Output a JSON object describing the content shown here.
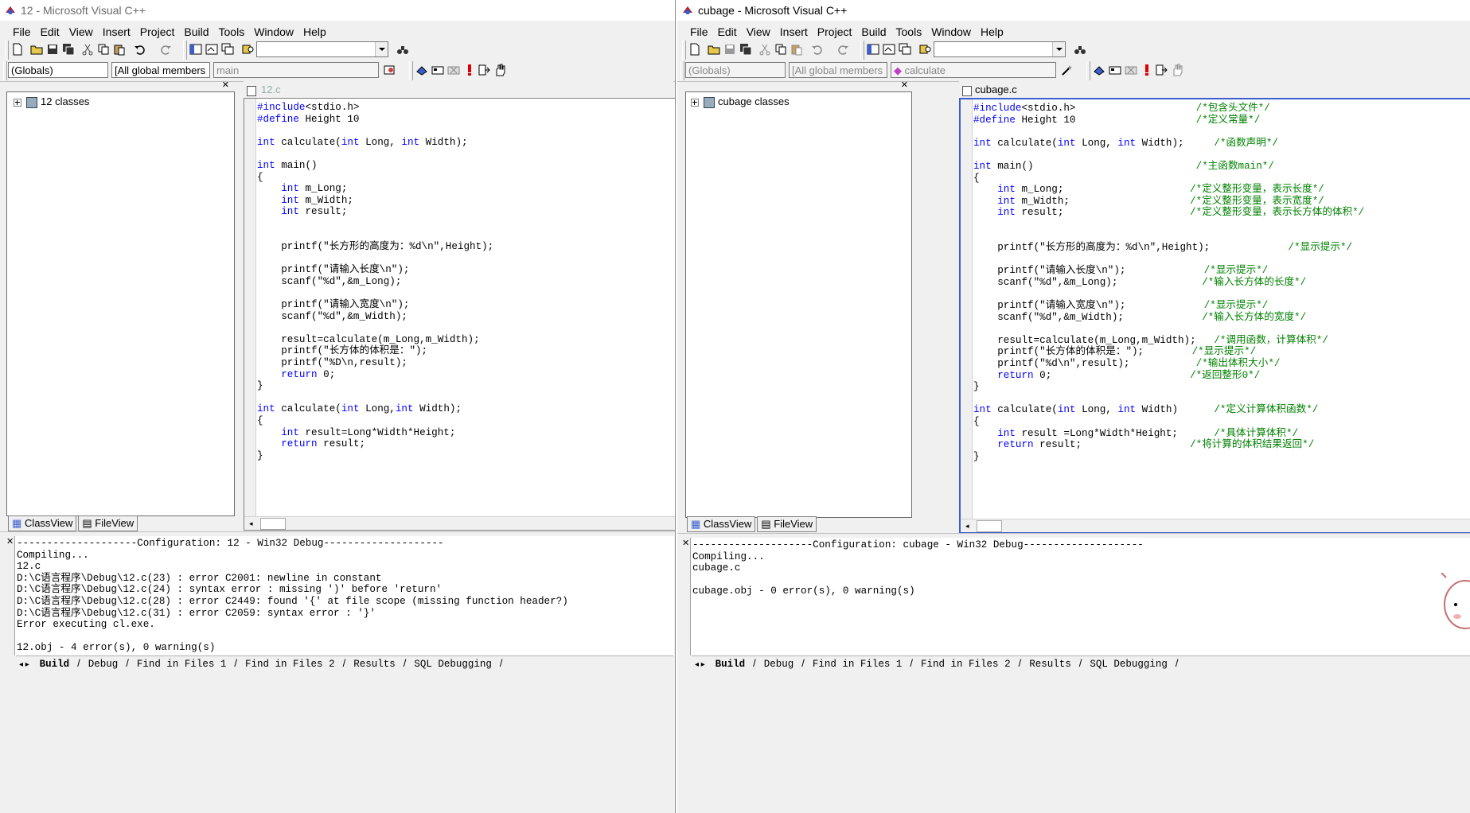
{
  "left_window": {
    "title": "12 - Microsoft Visual C++",
    "menu": [
      "File",
      "Edit",
      "View",
      "Insert",
      "Project",
      "Build",
      "Tools",
      "Window",
      "Help"
    ],
    "combo_class": "(Globals)",
    "combo_members": "[All global members",
    "combo_function": "main",
    "workspace_tree_item": "12 classes",
    "workspace_tabs": [
      "ClassView",
      "FileView"
    ],
    "editor_tab": "12.c",
    "output_tabs": [
      "Build",
      "Debug",
      "Find in Files 1",
      "Find in Files 2",
      "Results",
      "SQL Debugging"
    ],
    "output_lines": [
      "--------------------Configuration: 12 - Win32 Debug--------------------",
      "Compiling...",
      "12.c",
      "D:\\C语言程序\\Debug\\12.c(23) : error C2001: newline in constant",
      "D:\\C语言程序\\Debug\\12.c(24) : syntax error : missing ')' before 'return'",
      "D:\\C语言程序\\Debug\\12.c(28) : error C2449: found '{' at file scope (missing function header?)",
      "D:\\C语言程序\\Debug\\12.c(31) : error C2059: syntax error : '}'",
      "Error executing cl.exe.",
      "",
      "12.obj - 4 error(s), 0 warning(s)"
    ]
  },
  "right_window": {
    "title": "cubage - Microsoft Visual C++",
    "menu": [
      "File",
      "Edit",
      "View",
      "Insert",
      "Project",
      "Build",
      "Tools",
      "Window",
      "Help"
    ],
    "combo_class": "(Globals)",
    "combo_members": "[All global members",
    "combo_function": "calculate",
    "workspace_tree_item": "cubage classes",
    "workspace_tabs": [
      "ClassView",
      "FileView"
    ],
    "editor_tab": "cubage.c",
    "output_tabs": [
      "Build",
      "Debug",
      "Find in Files 1",
      "Find in Files 2",
      "Results",
      "SQL Debugging"
    ],
    "output_lines": [
      "--------------------Configuration: cubage - Win32 Debug--------------------",
      "Compiling...",
      "cubage.c",
      "",
      "cubage.obj - 0 error(s), 0 warning(s)"
    ]
  },
  "left_code": [
    [
      [
        "kw",
        "#include"
      ],
      [
        "",
        "<stdio.h>"
      ]
    ],
    [
      [
        "kw",
        "#define"
      ],
      [
        "",
        " Height 10"
      ]
    ],
    [],
    [
      [
        "kw",
        "int"
      ],
      [
        "",
        " calculate("
      ],
      [
        "kw",
        "int"
      ],
      [
        "",
        " Long, "
      ],
      [
        "kw",
        "int"
      ],
      [
        "",
        " Width);"
      ]
    ],
    [],
    [
      [
        "kw",
        "int"
      ],
      [
        "",
        " main()"
      ]
    ],
    [
      [
        "",
        "{"
      ]
    ],
    [
      [
        "",
        "    "
      ],
      [
        "kw",
        "int"
      ],
      [
        "",
        " m_Long;"
      ]
    ],
    [
      [
        "",
        "    "
      ],
      [
        "kw",
        "int"
      ],
      [
        "",
        " m_Width;"
      ]
    ],
    [
      [
        "",
        "    "
      ],
      [
        "kw",
        "int"
      ],
      [
        "",
        " result;"
      ]
    ],
    [],
    [],
    [
      [
        "",
        "    printf(\"长方形的高度为：%d\\n\",Height);"
      ]
    ],
    [],
    [
      [
        "",
        "    printf(\"请输入长度\\n\");"
      ]
    ],
    [
      [
        "",
        "    scanf(\"%d\",&m_Long);"
      ]
    ],
    [],
    [
      [
        "",
        "    printf(\"请输入宽度\\n\");"
      ]
    ],
    [
      [
        "",
        "    scanf(\"%d\",&m_Width);"
      ]
    ],
    [],
    [
      [
        "",
        "    result=calculate(m_Long,m_Width);"
      ]
    ],
    [
      [
        "",
        "    printf(\"长方体的体积是：\");"
      ]
    ],
    [
      [
        "",
        "    printf(\"%D\\n,result);"
      ]
    ],
    [
      [
        "",
        "    "
      ],
      [
        "kw",
        "return"
      ],
      [
        "",
        " 0;"
      ]
    ],
    [
      [
        "",
        "}"
      ]
    ],
    [],
    [
      [
        "kw",
        "int"
      ],
      [
        "",
        " calculate("
      ],
      [
        "kw",
        "int"
      ],
      [
        "",
        " Long,"
      ],
      [
        "kw",
        "int"
      ],
      [
        "",
        " Width);"
      ]
    ],
    [
      [
        "",
        "{"
      ]
    ],
    [
      [
        "",
        "    "
      ],
      [
        "kw",
        "int"
      ],
      [
        "",
        " result=Long*Width*Height;"
      ]
    ],
    [
      [
        "",
        "    "
      ],
      [
        "kw",
        "return"
      ],
      [
        "",
        " result;"
      ]
    ],
    [
      [
        "",
        "}"
      ]
    ]
  ],
  "right_code": [
    [
      [
        "kw",
        "#include"
      ],
      [
        "",
        "<stdio.h>                    "
      ],
      [
        "cm",
        "/*包含头文件*/"
      ]
    ],
    [
      [
        "kw",
        "#define"
      ],
      [
        "",
        " Height 10                    "
      ],
      [
        "cm",
        "/*定义常量*/"
      ]
    ],
    [],
    [
      [
        "kw",
        "int"
      ],
      [
        "",
        " calculate("
      ],
      [
        "kw",
        "int"
      ],
      [
        "",
        " Long, "
      ],
      [
        "kw",
        "int"
      ],
      [
        "",
        " Width);     "
      ],
      [
        "cm",
        "/*函数声明*/"
      ]
    ],
    [],
    [
      [
        "kw",
        "int"
      ],
      [
        "",
        " main()                           "
      ],
      [
        "cm",
        "/*主函数main*/"
      ]
    ],
    [
      [
        "",
        "{"
      ]
    ],
    [
      [
        "",
        "    "
      ],
      [
        "kw",
        "int"
      ],
      [
        "",
        " m_Long;                     "
      ],
      [
        "cm",
        "/*定义整形变量，表示长度*/"
      ]
    ],
    [
      [
        "",
        "    "
      ],
      [
        "kw",
        "int"
      ],
      [
        "",
        " m_Width;                    "
      ],
      [
        "cm",
        "/*定义整形变量，表示宽度*/"
      ]
    ],
    [
      [
        "",
        "    "
      ],
      [
        "kw",
        "int"
      ],
      [
        "",
        " result;                     "
      ],
      [
        "cm",
        "/*定义整形变量，表示长方体的体积*/"
      ]
    ],
    [],
    [],
    [
      [
        "",
        "    printf(\"长方形的高度为：%d\\n\",Height);             "
      ],
      [
        "cm",
        "/*显示提示*/"
      ]
    ],
    [],
    [
      [
        "",
        "    printf(\"请输入长度\\n\");             "
      ],
      [
        "cm",
        "/*显示提示*/"
      ]
    ],
    [
      [
        "",
        "    scanf(\"%d\",&m_Long);              "
      ],
      [
        "cm",
        "/*输入长方体的长度*/"
      ]
    ],
    [],
    [
      [
        "",
        "    printf(\"请输入宽度\\n\");             "
      ],
      [
        "cm",
        "/*显示提示*/"
      ]
    ],
    [
      [
        "",
        "    scanf(\"%d\",&m_Width);             "
      ],
      [
        "cm",
        "/*输入长方体的宽度*/"
      ]
    ],
    [],
    [
      [
        "",
        "    result=calculate(m_Long,m_Width);   "
      ],
      [
        "cm",
        "/*调用函数，计算体积*/"
      ]
    ],
    [
      [
        "",
        "    printf(\"长方体的体积是：\");        "
      ],
      [
        "cm",
        "/*显示提示*/"
      ]
    ],
    [
      [
        "",
        "    printf(\"%d\\n\",result);           "
      ],
      [
        "cm",
        "/*输出体积大小*/"
      ]
    ],
    [
      [
        "",
        "    "
      ],
      [
        "kw",
        "return"
      ],
      [
        "",
        " 0;                       "
      ],
      [
        "cm",
        "/*返回整形0*/"
      ]
    ],
    [
      [
        "",
        "}"
      ]
    ],
    [],
    [
      [
        "kw",
        "int"
      ],
      [
        "",
        " calculate("
      ],
      [
        "kw",
        "int"
      ],
      [
        "",
        " Long, "
      ],
      [
        "kw",
        "int"
      ],
      [
        "",
        " Width)      "
      ],
      [
        "cm",
        "/*定义计算体积函数*/"
      ]
    ],
    [
      [
        "",
        "{"
      ]
    ],
    [
      [
        "",
        "    "
      ],
      [
        "kw",
        "int"
      ],
      [
        "",
        " result =Long*Width*Height;      "
      ],
      [
        "cm",
        "/*具体计算体积*/"
      ]
    ],
    [
      [
        "",
        "    "
      ],
      [
        "kw",
        "return"
      ],
      [
        "",
        " result;                  "
      ],
      [
        "cm",
        "/*将计算的体积结果返回*/"
      ]
    ],
    [
      [
        "",
        "}"
      ]
    ]
  ],
  "colors": {
    "keyword": "#0000ff",
    "comment": "#008000",
    "chrome": "#f0f0f0"
  }
}
